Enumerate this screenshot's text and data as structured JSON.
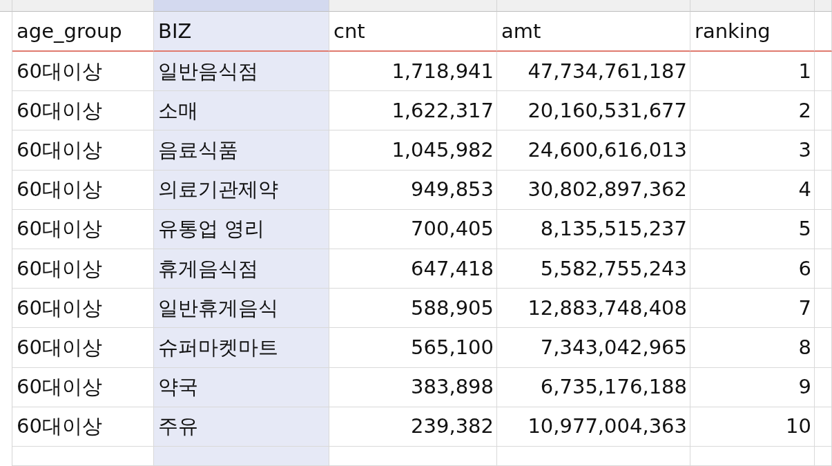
{
  "columns": [
    {
      "label": "age_group",
      "selected": false,
      "kind": "text"
    },
    {
      "label": "BIZ",
      "selected": true,
      "kind": "text"
    },
    {
      "label": "cnt",
      "selected": false,
      "kind": "number"
    },
    {
      "label": "amt",
      "selected": false,
      "kind": "number"
    },
    {
      "label": "ranking",
      "selected": false,
      "kind": "number"
    }
  ],
  "rows": [
    [
      "60대이상",
      "일반음식점",
      "1,718,941",
      "47,734,761,187",
      "1"
    ],
    [
      "60대이상",
      "소매",
      "1,622,317",
      "20,160,531,677",
      "2"
    ],
    [
      "60대이상",
      "음료식품",
      "1,045,982",
      "24,600,616,013",
      "3"
    ],
    [
      "60대이상",
      "의료기관제약",
      "949,853",
      "30,802,897,362",
      "4"
    ],
    [
      "60대이상",
      "유통업 영리",
      "700,405",
      "8,135,515,237",
      "5"
    ],
    [
      "60대이상",
      "휴게음식점",
      "647,418",
      "5,582,755,243",
      "6"
    ],
    [
      "60대이상",
      "일반휴게음식",
      "588,905",
      "12,883,748,408",
      "7"
    ],
    [
      "60대이상",
      "슈퍼마켓마트",
      "565,100",
      "7,343,042,965",
      "8"
    ],
    [
      "60대이상",
      "약국",
      "383,898",
      "6,735,176,188",
      "9"
    ],
    [
      "60대이상",
      "주유",
      "239,382",
      "10,977,004,363",
      "10"
    ]
  ]
}
